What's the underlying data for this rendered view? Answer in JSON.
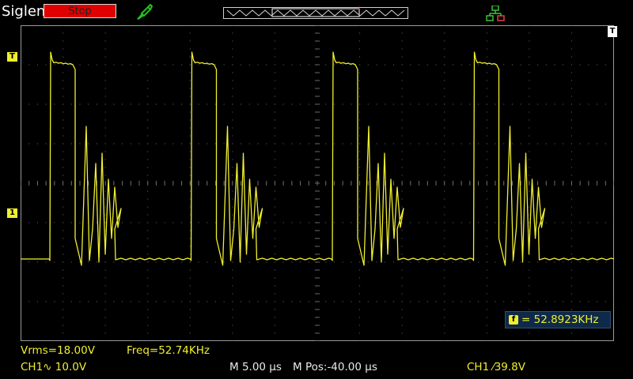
{
  "header": {
    "brand": "Siglent",
    "run_state": "Stop"
  },
  "channel_markers": {
    "trigger_level_glyph": "T",
    "ch1_glyph": "1",
    "trigger_pos_glyph": "T"
  },
  "measurements": {
    "vrms": "Vrms=18.00V",
    "freq": "Freq=52.74KHz"
  },
  "frequency_counter": {
    "icon_glyph": "f",
    "value": "= 52.8923KHz"
  },
  "status": {
    "ch1_scale": "CH1∿ 10.0V",
    "timebase": "M 5.00 µs",
    "h_position": "M Pos:-40.00 µs",
    "trigger": "CH1 ⁄39.8V"
  },
  "colors": {
    "trace": "#f0ef2e",
    "grid": "#6b6b6b",
    "stop": "#e00000",
    "counter_bg": "#0e2a4a"
  },
  "icons": {
    "probe": "probe-icon",
    "network": "network-icon",
    "timebase_window": "timebase-window-icon"
  }
}
